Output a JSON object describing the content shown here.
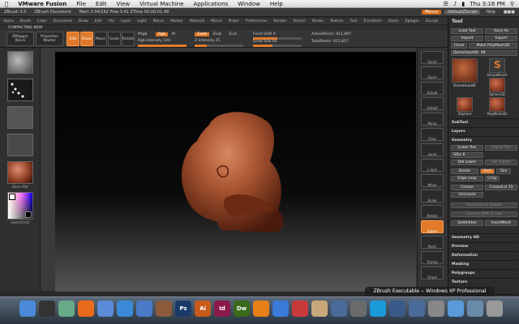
{
  "macbar": {
    "apple": "",
    "app": "VMware Fusion",
    "menus": [
      "File",
      "Edit",
      "View",
      "Virtual Machine",
      "Applications",
      "Window",
      "Help"
    ],
    "clock": "Thu 3:16 PM"
  },
  "ztitle": {
    "app": "ZBrush 3.5",
    "doc": "ZBrush Document",
    "mem": "Mem 3.94/162  Free 3.41  ZTime 00:00:01.48",
    "menus_btn": "Menus",
    "script_btn": "DefaultZScript",
    "help": "Help"
  },
  "zmenu": [
    "Alpha",
    "Brush",
    "Color",
    "Document",
    "Draw",
    "Edit",
    "File",
    "Layer",
    "Light",
    "Macro",
    "Marker",
    "Material",
    "Movie",
    "Picker",
    "Preferences",
    "Render",
    "Stencil",
    "Stroke",
    "Texture",
    "Tool",
    "Transform",
    "Zoom",
    "Zplugin",
    "Zscript"
  ],
  "zsub": "COMPACTING MEM",
  "shelf": {
    "zmapper": "ZMapper",
    "zmapper_sub": "Rev-E",
    "projection": "Projection",
    "projection_sub": "Master",
    "edit": "Edit",
    "draw": "Draw",
    "move": "Move",
    "scale": "Scale",
    "rotate": "Rotate",
    "mrgb": "Mrgb",
    "rgb": "Rgb",
    "m": "M",
    "rgb_intensity": "Rgb Intensity 100",
    "zadd": "Zadd",
    "zsub": "Zsub",
    "zcut": "Zcut",
    "z_intensity": "Z Intensity 25",
    "focal_shift": "Focal Shift 0",
    "draw_size": "Draw Size 64",
    "active_points": "ActivePoints: 911,897",
    "total_points": "TotalPoints: 921,817"
  },
  "leftpanel": [
    "",
    "",
    "",
    "",
    "Basic Mat",
    "SwitchColor"
  ],
  "rstrip": [
    "Scroll",
    "Zoom",
    "Actual",
    "AAHalf",
    "Persp",
    "Floor",
    "Local",
    "L.Sym",
    "Move",
    "Scale",
    "Rotate",
    "Xpose",
    "PolyF",
    "Transp",
    "Ghost"
  ],
  "tool": {
    "title": "Tool",
    "load": "Load Tool",
    "saveas": "Save As",
    "import": "Import",
    "export": "Export",
    "clone": "Clone",
    "make": "Make PolyMesh3D",
    "current": "DemoHead48. 48",
    "thumbs": [
      "DemoHead48",
      "SimpleBrush",
      "Sphere3D",
      "ZSphere",
      "PolyMesh3D"
    ],
    "subtool": "SubTool",
    "layers": "Layers",
    "geometry": "Geometry",
    "lower_res": "Lower Res",
    "higher_res": "Higher Res",
    "sdiv": "SDiv 6",
    "del_lower": "Del Lower",
    "del_higher": "Del Higher",
    "divide": "Divide",
    "smt": "Smt",
    "suv": "Suv",
    "edge_loop": "Edge Loop",
    "crisp": "Crisp",
    "crease": "Crease",
    "crease_lvl": "CreaseLvl 15",
    "uncrease": "Uncrease",
    "reconstruct": "Reconstruct Subdiv",
    "convert": "Convert BPR To Geo",
    "deleteh": "DelHidden",
    "insertmesh": "InsertMesh",
    "geometry_hd": "Geometry HD",
    "preview": "Preview",
    "deformation": "Deformation",
    "masking": "Masking",
    "polygroups": "Polygroups",
    "texture": "Texture",
    "displacement": "Displacement"
  },
  "toast": "ZBrush Executable -- Windows XP Professional",
  "dock": [
    "Finder",
    "Dashboard",
    "Growl",
    "Firefox",
    "Preview",
    "iChat",
    "Mail",
    "Photos",
    "Ps",
    "Ai",
    "Id",
    "Dw",
    "Blender",
    "Safari",
    "iCal",
    "Library",
    "Pencil",
    "Photo",
    "Skype",
    "VMware",
    "VMware2",
    "ZBrush",
    "Folder",
    "Docs",
    "Trash"
  ],
  "colors": {
    "accent": "#e07a2a",
    "clay": "#a4522f",
    "panel": "#2c2c2c"
  }
}
